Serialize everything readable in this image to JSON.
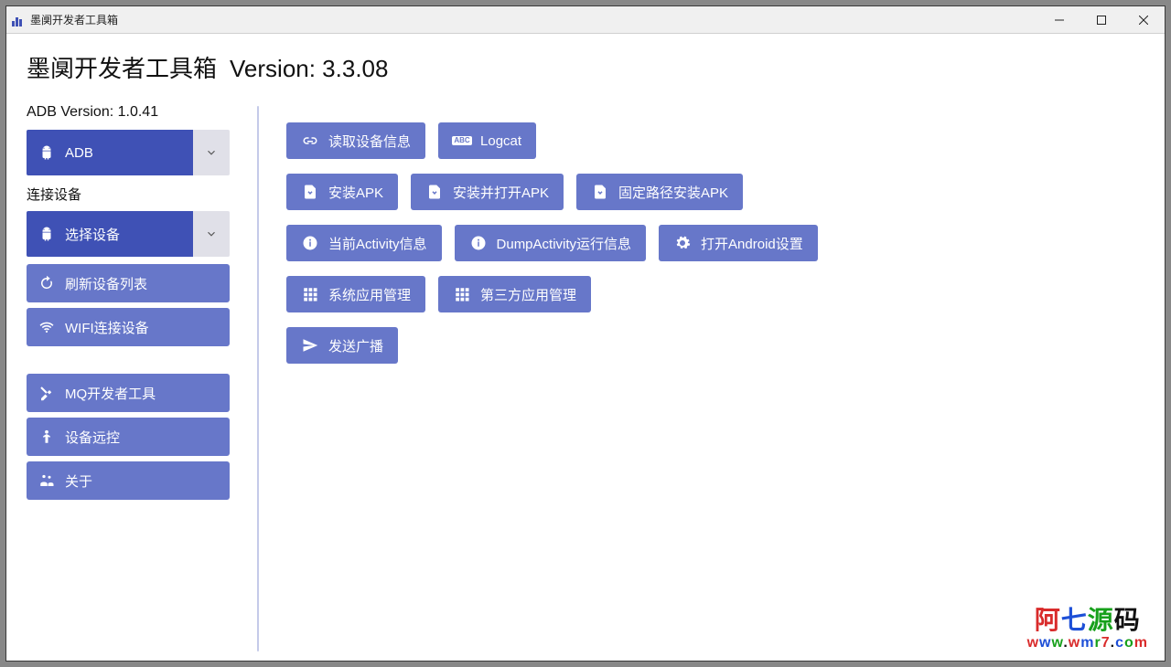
{
  "window": {
    "title": "墨阒开发者工具箱"
  },
  "header": {
    "app_name": "墨阒开发者工具箱",
    "version_label": "Version: 3.3.08"
  },
  "sidebar": {
    "adb_version_text": "ADB Version:  1.0.41",
    "adb_combo_label": "ADB",
    "connect_label": "连接设备",
    "device_combo_label": "选择设备",
    "refresh_label": "刷新设备列表",
    "wifi_label": "WIFI连接设备",
    "mq_label": "MQ开发者工具",
    "remote_label": "设备远控",
    "about_label": "关于"
  },
  "actions": {
    "row1": {
      "read_info": "读取设备信息",
      "logcat": "Logcat"
    },
    "row2": {
      "install_apk": "安装APK",
      "install_open_apk": "安装并打开APK",
      "install_fixed_path": "固定路径安装APK"
    },
    "row3": {
      "current_activity": "当前Activity信息",
      "dump_activity": "DumpActivity运行信息",
      "open_settings": "打开Android设置"
    },
    "row4": {
      "sys_app_mgr": "系统应用管理",
      "third_app_mgr": "第三方应用管理"
    },
    "row5": {
      "send_broadcast": "发送广播"
    }
  },
  "watermark": {
    "line1": "阿七源码",
    "line2": "www.wmr7.com"
  }
}
